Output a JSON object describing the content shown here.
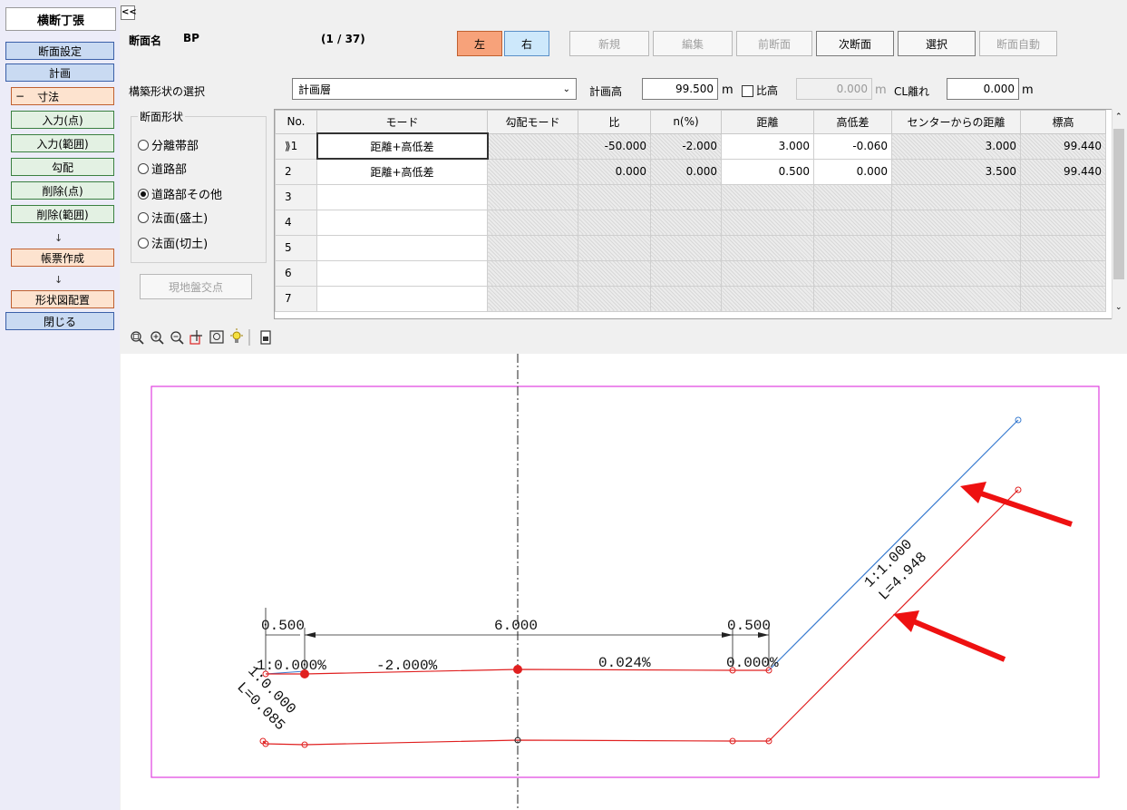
{
  "sidebar": {
    "title": "横断丁張",
    "items": [
      {
        "label": "断面設定"
      },
      {
        "label": "計画"
      },
      {
        "label": "寸法",
        "expander": "−"
      },
      {
        "label": "入力(点)"
      },
      {
        "label": "入力(範囲)"
      },
      {
        "label": "勾配"
      },
      {
        "label": "削除(点)"
      },
      {
        "label": "削除(範囲)"
      },
      {
        "label": "帳票作成"
      },
      {
        "label": "形状図配置"
      },
      {
        "label": "閉じる"
      }
    ],
    "arrow": "↓",
    "collapse": "<<"
  },
  "header": {
    "section_name_label": "断面名",
    "section_name": "BP",
    "counter": "(1 / 37)",
    "buttons": {
      "left": "左",
      "right": "右",
      "new": "新規",
      "edit": "編集",
      "prev": "前断面",
      "next": "次断面",
      "select": "選択",
      "auto": "断面自動"
    }
  },
  "form": {
    "shape_select_label": "構築形状の選択",
    "shape_select_value": "計画層",
    "plan_height_label": "計画高",
    "plan_height_value": "99.500",
    "unit_m": "m",
    "ratio_label": "比高",
    "ratio_value": "0.000",
    "cl_label": "CL離れ",
    "cl_value": "0.000",
    "section_shape_label": "断面形状",
    "radios": [
      {
        "label": "分離帯部",
        "checked": false
      },
      {
        "label": "道路部",
        "checked": false
      },
      {
        "label": "道路部その他",
        "checked": true
      },
      {
        "label": "法面(盛土)",
        "checked": false
      },
      {
        "label": "法面(切土)",
        "checked": false
      }
    ],
    "ground_button": "現地盤交点"
  },
  "table": {
    "headers": [
      "No.",
      "モード",
      "勾配モード",
      "比",
      "n(%)",
      "距離",
      "高低差",
      "センターからの距離",
      "標高"
    ],
    "rows": [
      {
        "no": "⟫1",
        "mode": "距離+高低差",
        "grad": "",
        "ratio": "-50.000",
        "n": "-2.000",
        "dist": "3.000",
        "height": "-0.060",
        "center": "3.000",
        "elev": "99.440"
      },
      {
        "no": "2",
        "mode": "距離+高低差",
        "grad": "",
        "ratio": "0.000",
        "n": "0.000",
        "dist": "0.500",
        "height": "0.000",
        "center": "3.500",
        "elev": "99.440"
      },
      {
        "no": "3"
      },
      {
        "no": "4"
      },
      {
        "no": "5"
      },
      {
        "no": "6"
      },
      {
        "no": "7"
      }
    ]
  },
  "toolbar": {
    "icons": [
      "zoom-fit-icon",
      "zoom-in-icon",
      "zoom-out-icon",
      "pan-icon",
      "zoom-window-icon",
      "light-icon",
      "print-icon"
    ]
  },
  "drawing": {
    "dims": [
      "0.500",
      "6.000",
      "0.500"
    ],
    "slopes": [
      "1:0.000%",
      "-2.000%",
      "0.024%",
      "0.000%"
    ],
    "slope_left": "1:0.000",
    "length_left": "L=0.085",
    "slope_right": "1:1.000",
    "length_right": "L=4.948",
    "colors": {
      "frame": "#e040e0",
      "plan": "#e02020",
      "slope_line": "#3a7cd0",
      "arrow": "#ee1111"
    }
  }
}
